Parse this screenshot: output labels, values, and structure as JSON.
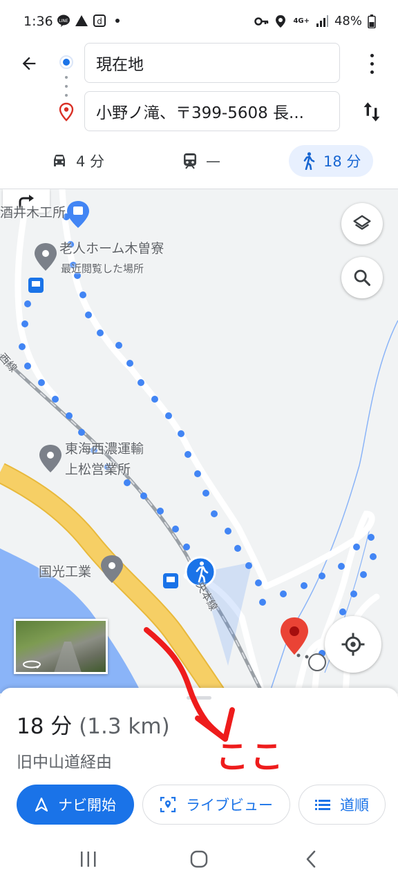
{
  "status_bar": {
    "time": "1:36",
    "left_icons": [
      "line-icon",
      "warning-icon",
      "d-icon",
      "dot-icon"
    ],
    "right_icons": [
      "key-icon",
      "location-icon",
      "4g-icon",
      "signal-icon",
      "battery-icon"
    ],
    "network": "4G+",
    "battery": "48%"
  },
  "route": {
    "origin": "現在地",
    "destination": "小野ノ滝、〒399-5608 長..."
  },
  "modes": {
    "car": "4 分",
    "transit": "—",
    "walk": "18 分"
  },
  "map": {
    "labels": {
      "shop_partial": "酒井木工所",
      "nursing_home": "老人ホーム木曽寮",
      "recent": "最近閲覧した場所",
      "transport_1": "東海西濃運輸",
      "transport_2": "上松営業所",
      "factory": "国光工業",
      "rail_left": "西線",
      "rail_center": "央本線"
    }
  },
  "sheet": {
    "duration": "18 分",
    "distance": "(1.3 km)",
    "via": "旧中山道経由",
    "start_button": "ナビ開始",
    "live_view_button": "ライブビュー",
    "steps_button": "道順"
  },
  "annotation": {
    "text": "ここ",
    "color": "#ee1c1c"
  },
  "colors": {
    "accent": "#1a73e8",
    "route_dot": "#4285f4",
    "destination_pin": "#ea4335",
    "road_major": "#f6cf65"
  }
}
